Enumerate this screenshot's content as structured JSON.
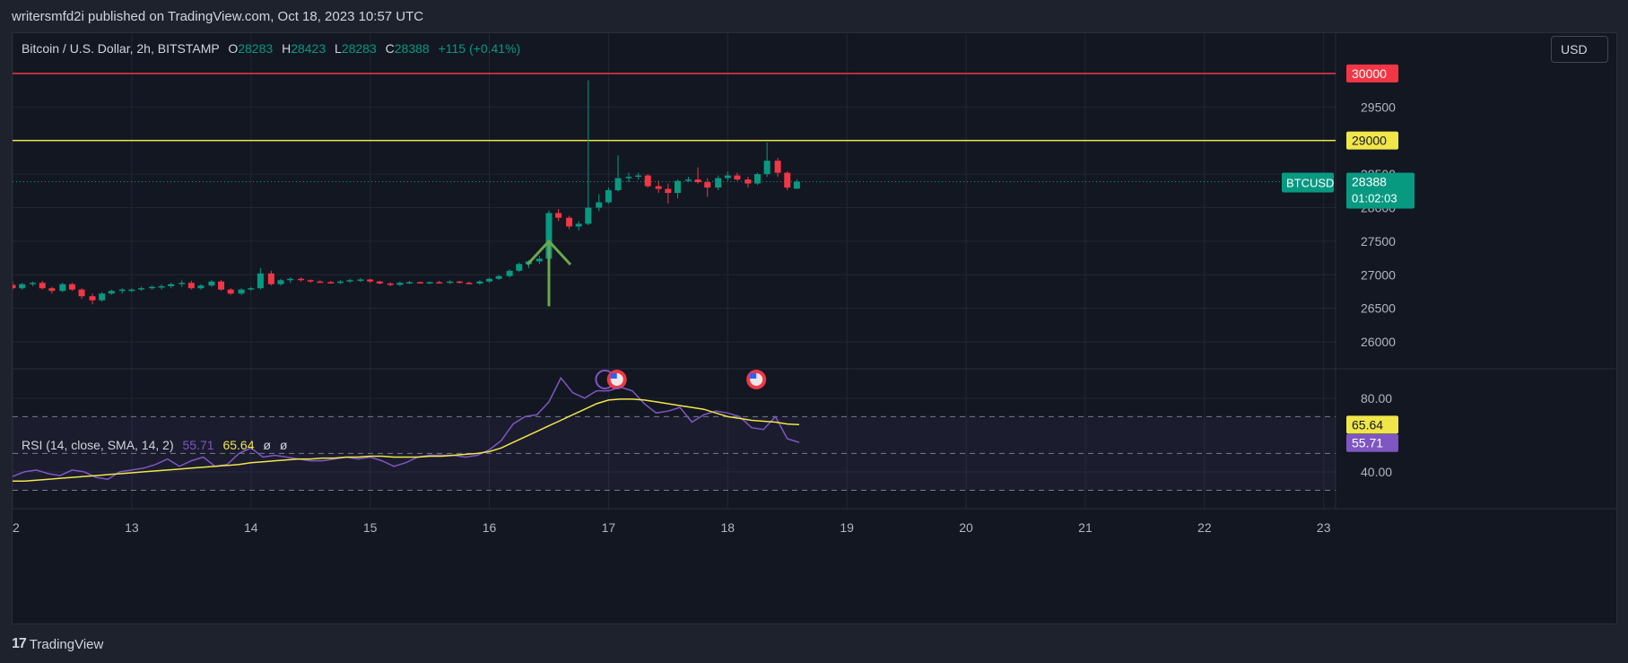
{
  "header": {
    "published": "writersmfd2i published on TradingView.com, Oct 18, 2023 10:57 UTC"
  },
  "legend": {
    "symbol": "Bitcoin / U.S. Dollar, 2h, BITSTAMP",
    "o_label": "O",
    "o": "28283",
    "h_label": "H",
    "h": "28423",
    "l_label": "L",
    "l": "28283",
    "c_label": "C",
    "c": "28388",
    "change": "+115 (+0.41%)"
  },
  "currency_button": "USD",
  "rsi_legend": {
    "label": "RSI (14, close, SMA, 14, 2)",
    "rsi": "55.71",
    "ma": "65.64",
    "n1": "ø",
    "n2": "ø"
  },
  "footer": {
    "logo": "17",
    "brand": "TradingView"
  },
  "colors": {
    "up": "#089981",
    "down": "#f23645",
    "rsi": "#7e57c2",
    "rsi_ma": "#f0e64a",
    "resistance": "#f23645",
    "support": "#f0e64a",
    "arrow": "#6aa84f"
  },
  "chart_data": [
    {
      "type": "candlestick",
      "symbol": "BTCUSD",
      "timeframe": "2h",
      "x_ticks": [
        "2",
        "13",
        "14",
        "15",
        "16",
        "17",
        "18",
        "19",
        "20",
        "21",
        "22",
        "23"
      ],
      "x_range": [
        12.0,
        23.1
      ],
      "y_ticks": [
        26000,
        26500,
        27000,
        27500,
        28000,
        28500,
        29000,
        29500,
        30000
      ],
      "ylim": [
        25600,
        30600
      ],
      "price_lines": [
        {
          "label": "30000",
          "value": 30000,
          "color": "#f23645"
        },
        {
          "label": "29000",
          "value": 29000,
          "color": "#f0e64a"
        }
      ],
      "last_price": {
        "symbol": "BTCUSD",
        "value": 28388,
        "label": "28388",
        "countdown": "01:02:03"
      },
      "annotation_arrow": {
        "x": 16.5,
        "y_from": 26530,
        "y_to": 27500
      },
      "event_markers": [
        {
          "x": 16.97,
          "kind": "flash"
        },
        {
          "x": 17.07,
          "kind": "us-flag"
        },
        {
          "x": 18.24,
          "kind": "us-flag"
        }
      ],
      "candles": [
        [
          12.0,
          26850,
          26900,
          26780,
          26800
        ],
        [
          12.08,
          26800,
          26880,
          26780,
          26860
        ],
        [
          12.17,
          26860,
          26900,
          26830,
          26880
        ],
        [
          12.25,
          26880,
          26910,
          26780,
          26800
        ],
        [
          12.33,
          26800,
          26820,
          26720,
          26760
        ],
        [
          12.42,
          26760,
          26880,
          26740,
          26860
        ],
        [
          12.5,
          26860,
          26880,
          26760,
          26780
        ],
        [
          12.58,
          26780,
          26800,
          26640,
          26680
        ],
        [
          12.67,
          26680,
          26720,
          26560,
          26620
        ],
        [
          12.75,
          26620,
          26740,
          26600,
          26720
        ],
        [
          12.83,
          26720,
          26780,
          26700,
          26760
        ],
        [
          12.92,
          26760,
          26800,
          26720,
          26780
        ],
        [
          13.0,
          26780,
          26800,
          26740,
          26780
        ],
        [
          13.08,
          26780,
          26820,
          26760,
          26800
        ],
        [
          13.17,
          26800,
          26840,
          26780,
          26820
        ],
        [
          13.25,
          26820,
          26860,
          26780,
          26830
        ],
        [
          13.33,
          26830,
          26880,
          26800,
          26860
        ],
        [
          13.42,
          26860,
          26920,
          26820,
          26880
        ],
        [
          13.5,
          26880,
          26910,
          26780,
          26800
        ],
        [
          13.58,
          26800,
          26860,
          26780,
          26840
        ],
        [
          13.67,
          26840,
          26920,
          26820,
          26900
        ],
        [
          13.75,
          26900,
          26920,
          26760,
          26780
        ],
        [
          13.83,
          26780,
          26800,
          26700,
          26720
        ],
        [
          13.92,
          26720,
          26800,
          26700,
          26780
        ],
        [
          14.0,
          26780,
          26820,
          26760,
          26800
        ],
        [
          14.08,
          26800,
          27100,
          26780,
          27020
        ],
        [
          14.17,
          27020,
          27060,
          26840,
          26860
        ],
        [
          14.25,
          26860,
          26940,
          26840,
          26920
        ],
        [
          14.33,
          26920,
          26960,
          26880,
          26940
        ],
        [
          14.42,
          26940,
          26960,
          26900,
          26920
        ],
        [
          14.5,
          26920,
          26930,
          26880,
          26900
        ],
        [
          14.58,
          26900,
          26920,
          26880,
          26890
        ],
        [
          14.67,
          26890,
          26910,
          26870,
          26880
        ],
        [
          14.75,
          26880,
          26920,
          26860,
          26900
        ],
        [
          14.83,
          26900,
          26940,
          26880,
          26920
        ],
        [
          14.92,
          26920,
          26950,
          26890,
          26930
        ],
        [
          15.0,
          26930,
          26940,
          26880,
          26900
        ],
        [
          15.08,
          26900,
          26910,
          26860,
          26870
        ],
        [
          15.17,
          26870,
          26890,
          26830,
          26850
        ],
        [
          15.25,
          26850,
          26900,
          26830,
          26880
        ],
        [
          15.33,
          26880,
          26910,
          26860,
          26890
        ],
        [
          15.42,
          26890,
          26900,
          26870,
          26880
        ],
        [
          15.5,
          26880,
          26900,
          26860,
          26890
        ],
        [
          15.58,
          26890,
          26910,
          26870,
          26880
        ],
        [
          15.67,
          26880,
          26920,
          26860,
          26900
        ],
        [
          15.75,
          26900,
          26910,
          26870,
          26880
        ],
        [
          15.83,
          26880,
          26900,
          26860,
          26870
        ],
        [
          15.92,
          26870,
          26920,
          26850,
          26900
        ],
        [
          16.0,
          26900,
          26960,
          26880,
          26940
        ],
        [
          16.08,
          26940,
          27000,
          26920,
          26980
        ],
        [
          16.17,
          26980,
          27080,
          26960,
          27060
        ],
        [
          16.25,
          27060,
          27180,
          27040,
          27160
        ],
        [
          16.33,
          27160,
          27220,
          27100,
          27200
        ],
        [
          16.42,
          27200,
          27280,
          27160,
          27240
        ],
        [
          16.5,
          27240,
          27960,
          27220,
          27920
        ],
        [
          16.58,
          27920,
          27980,
          27800,
          27850
        ],
        [
          16.67,
          27850,
          27880,
          27680,
          27720
        ],
        [
          16.75,
          27720,
          27800,
          27660,
          27760
        ],
        [
          16.83,
          27760,
          29900,
          27740,
          28000
        ],
        [
          16.92,
          28000,
          28200,
          27950,
          28080
        ],
        [
          17.0,
          28080,
          28300,
          28060,
          28260
        ],
        [
          17.08,
          28260,
          28780,
          28240,
          28440
        ],
        [
          17.17,
          28440,
          28520,
          28380,
          28460
        ],
        [
          17.25,
          28460,
          28520,
          28420,
          28480
        ],
        [
          17.33,
          28480,
          28500,
          28300,
          28320
        ],
        [
          17.42,
          28320,
          28400,
          28220,
          28280
        ],
        [
          17.5,
          28280,
          28360,
          28060,
          28220
        ],
        [
          17.58,
          28220,
          28420,
          28140,
          28400
        ],
        [
          17.67,
          28400,
          28460,
          28380,
          28420
        ],
        [
          17.75,
          28420,
          28600,
          28360,
          28380
        ],
        [
          17.83,
          28380,
          28440,
          28160,
          28300
        ],
        [
          17.92,
          28300,
          28480,
          28260,
          28440
        ],
        [
          18.0,
          28440,
          28540,
          28400,
          28480
        ],
        [
          18.08,
          28480,
          28520,
          28400,
          28420
        ],
        [
          18.17,
          28420,
          28460,
          28300,
          28360
        ],
        [
          18.25,
          28360,
          28520,
          28340,
          28500
        ],
        [
          18.33,
          28500,
          28970,
          28460,
          28700
        ],
        [
          18.42,
          28700,
          28740,
          28460,
          28520
        ],
        [
          18.5,
          28520,
          28540,
          28260,
          28300
        ],
        [
          18.58,
          28283,
          28423,
          28283,
          28388
        ]
      ]
    },
    {
      "type": "line",
      "title": "RSI (14, close, SMA, 14, 2)",
      "y_ticks": [
        40,
        80
      ],
      "ylim": [
        20,
        96
      ],
      "bands": {
        "upper": 70,
        "middle": 50,
        "lower": 30
      },
      "last_values": {
        "rsi": 55.71,
        "rsi_label": "55.71",
        "ma": 65.64,
        "ma_label": "65.64"
      },
      "x": [
        12.0,
        12.1,
        12.2,
        12.3,
        12.4,
        12.5,
        12.6,
        12.7,
        12.8,
        12.9,
        13.0,
        13.1,
        13.2,
        13.3,
        13.4,
        13.5,
        13.6,
        13.7,
        13.8,
        13.9,
        14.0,
        14.1,
        14.2,
        14.3,
        14.4,
        14.5,
        14.6,
        14.7,
        14.8,
        14.9,
        15.0,
        15.1,
        15.2,
        15.3,
        15.4,
        15.5,
        15.6,
        15.7,
        15.8,
        15.9,
        16.0,
        16.1,
        16.2,
        16.3,
        16.4,
        16.5,
        16.6,
        16.7,
        16.8,
        16.9,
        17.0,
        17.1,
        17.2,
        17.3,
        17.4,
        17.5,
        17.6,
        17.7,
        17.8,
        17.9,
        18.0,
        18.1,
        18.2,
        18.3,
        18.4,
        18.5,
        18.6
      ],
      "series": [
        {
          "values": [
            37.5,
            40,
            41,
            39,
            38,
            41,
            40,
            37,
            36,
            40,
            41,
            42,
            44,
            47,
            43,
            46,
            48,
            43,
            44,
            50,
            53,
            48,
            49,
            48,
            47,
            46,
            46,
            47,
            48,
            47,
            48,
            46,
            43,
            45,
            48,
            49,
            49,
            49,
            48,
            49,
            52,
            57,
            66,
            70,
            71,
            78,
            91,
            83,
            80,
            84,
            84,
            86,
            84,
            77,
            72,
            73,
            75,
            67,
            71,
            73,
            72,
            70,
            64,
            63,
            70,
            58,
            56
          ],
          "color": "#7e57c2"
        },
        {
          "values": [
            35,
            35,
            35.5,
            36,
            36.5,
            37,
            37.5,
            38,
            38.5,
            39,
            39.5,
            40,
            40.5,
            41,
            41.5,
            42,
            42.5,
            43,
            43.5,
            44,
            45,
            45.5,
            46,
            46.5,
            47,
            47,
            47.5,
            47.5,
            48,
            48,
            48.5,
            48.5,
            48,
            48,
            48,
            48.5,
            48.5,
            49,
            49.5,
            50,
            51,
            53,
            56,
            59,
            62,
            65,
            68,
            71,
            74,
            77,
            79,
            79.5,
            79.5,
            79,
            78,
            77,
            76,
            75,
            74,
            72,
            70,
            69,
            68,
            67.5,
            67,
            66,
            65.64
          ],
          "color": "#f0e64a"
        }
      ]
    }
  ]
}
